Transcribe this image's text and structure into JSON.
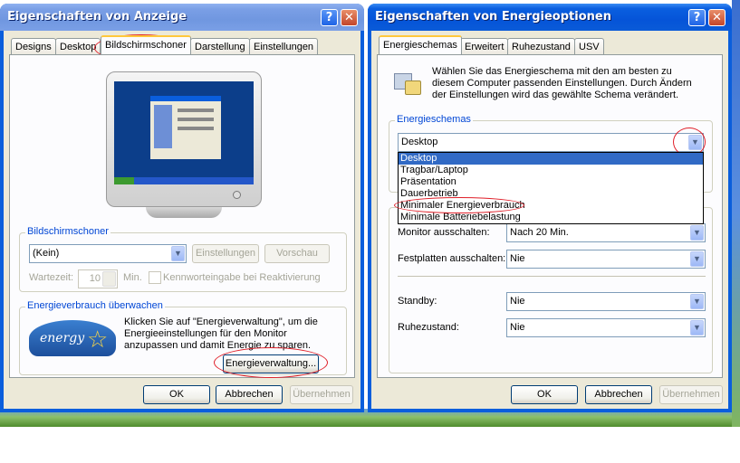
{
  "display_window": {
    "title": "Eigenschaften von Anzeige",
    "tabs": [
      "Designs",
      "Desktop",
      "Bildschirmschoner",
      "Darstellung",
      "Einstellungen"
    ],
    "screensaver": {
      "group_label": "Bildschirmschoner",
      "selected": "(Kein)",
      "settings_button": "Einstellungen",
      "preview_button": "Vorschau",
      "wait_label": "Wartezeit:",
      "wait_value": "10",
      "minutes_label": "Min.",
      "password_label": "Kennworteingabe bei Reaktivierung"
    },
    "power": {
      "group_label": "Energieverbrauch überwachen",
      "description": "Klicken Sie auf \"Energieverwaltung\", um die Energieeinstellungen für den Monitor anzupassen und damit Energie zu sparen.",
      "button": "Energieverwaltung...",
      "logo_text": "energy"
    },
    "buttons": {
      "ok": "OK",
      "cancel": "Abbrechen",
      "apply": "Übernehmen"
    }
  },
  "power_window": {
    "title": "Eigenschaften von Energieoptionen",
    "tabs": [
      "Energieschemas",
      "Erweitert",
      "Ruhezustand",
      "USV"
    ],
    "intro": "Wählen Sie das Energieschema mit den am besten zu diesem Computer passenden Einstellungen. Durch Ändern der Einstellungen wird das gewählte Schema verändert.",
    "schemes": {
      "group_label": "Energieschemas",
      "selected": "Desktop",
      "options": [
        "Desktop",
        "Tragbar/Laptop",
        "Präsentation",
        "Dauerbetrieb",
        "Minimaler Energieverbrauch",
        "Minimale Batteriebelastung"
      ]
    },
    "settings": [
      {
        "label": "Monitor ausschalten:",
        "value": "Nach 20 Min."
      },
      {
        "label": "Festplatten ausschalten:",
        "value": "Nie"
      },
      {
        "label": "Standby:",
        "value": "Nie"
      },
      {
        "label": "Ruhezustand:",
        "value": "Nie"
      }
    ],
    "buttons": {
      "ok": "OK",
      "cancel": "Abbrechen",
      "apply": "Übernehmen"
    }
  },
  "icons": {
    "help": "?",
    "close": "✕",
    "dropdown": "▼"
  },
  "colors": {
    "xp_blue": "#0a5edc",
    "group_label": "#0046d5",
    "selection": "#316ac5",
    "annotation": "#e0202a"
  }
}
